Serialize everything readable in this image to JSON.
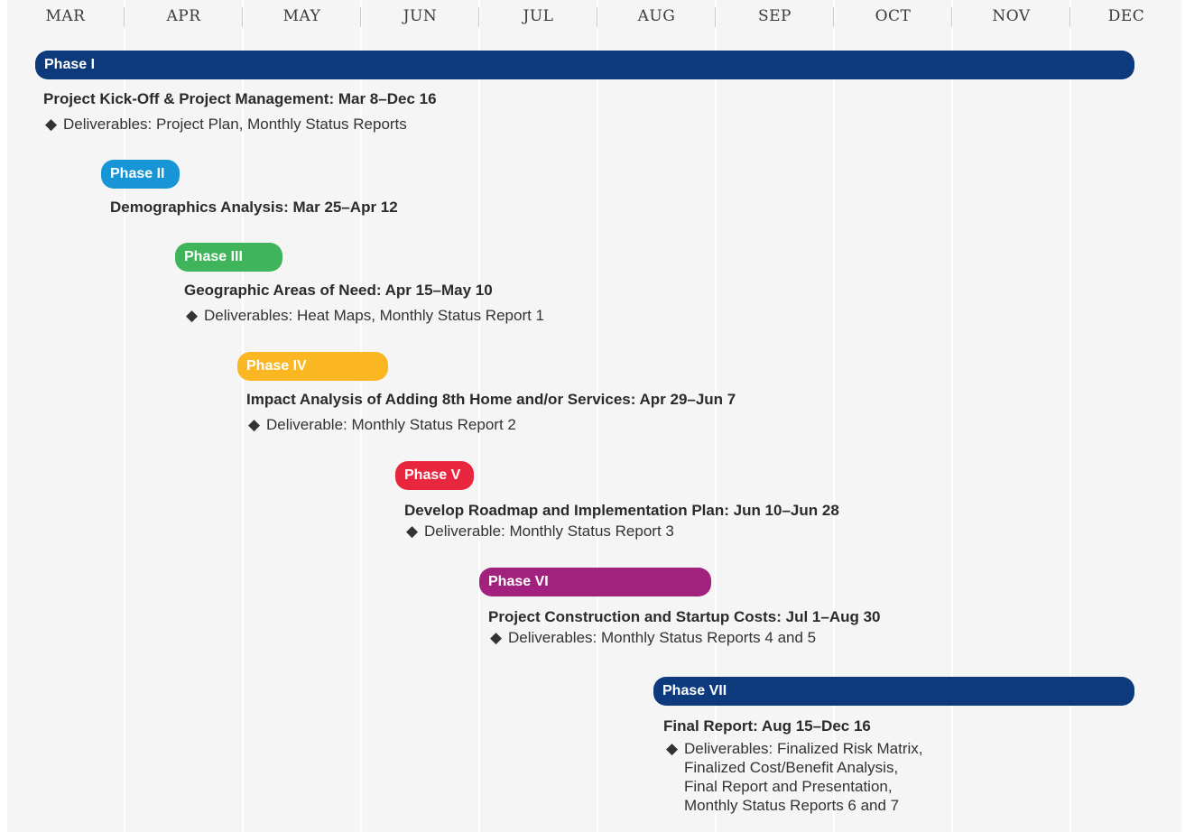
{
  "months": [
    "MAR",
    "APR",
    "MAY",
    "JUN",
    "JUL",
    "AUG",
    "SEP",
    "OCT",
    "NOV",
    "DEC"
  ],
  "diamond": "◆",
  "phases": [
    {
      "label": "Phase I",
      "color": "#0c3a7d",
      "title": "Project Kick-Off & Project Management: Mar 8–Dec 16",
      "deliverables": [
        "Deliverables: Project Plan, Monthly Status Reports"
      ]
    },
    {
      "label": "Phase II",
      "color": "#1795d6",
      "title": "Demographics Analysis: Mar 25–Apr 12",
      "deliverables": []
    },
    {
      "label": "Phase III",
      "color": "#3fb45a",
      "title": "Geographic Areas of Need: Apr 15–May 10",
      "deliverables": [
        "Deliverables: Heat Maps, Monthly Status Report 1"
      ]
    },
    {
      "label": "Phase IV",
      "color": "#fbb722",
      "title": "Impact Analysis of Adding 8th Home and/or Services: Apr 29–Jun 7",
      "deliverables": [
        "Deliverable: Monthly Status Report 2"
      ]
    },
    {
      "label": "Phase V",
      "color": "#e8273f",
      "title": "Develop Roadmap and Implementation Plan: Jun 10–Jun 28",
      "deliverables": [
        "Deliverable: Monthly Status Report 3"
      ]
    },
    {
      "label": "Phase VI",
      "color": "#a2217f",
      "title": "Project Construction and Startup Costs: Jul 1–Aug 30",
      "deliverables": [
        "Deliverables: Monthly Status Reports 4 and 5"
      ]
    },
    {
      "label": "Phase VII",
      "color": "#0c3a7d",
      "title": "Final Report: Aug 15–Dec 16",
      "deliverables": [
        "Deliverables: Finalized Risk Matrix,",
        "Finalized Cost/Benefit Analysis,",
        "Final Report and Presentation,",
        "Monthly Status Reports 6 and 7"
      ]
    }
  ]
}
